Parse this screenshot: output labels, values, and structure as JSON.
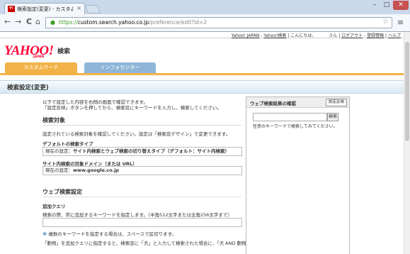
{
  "browser": {
    "tab_title": "検索設定(変更) - カスタム",
    "tab_favicon": "Y!",
    "url_scheme": "https://",
    "url_host": "custom.search.yahoo.co.jp",
    "url_path": "/preference/edit?id=2",
    "window_minimize": "–",
    "window_maximize": "□",
    "window_close": "✕",
    "back_icon": "←",
    "forward_icon": "→",
    "reload_icon": "C",
    "home_icon": "⌂",
    "star_icon": "☆",
    "menu_icon": "≡",
    "tab_close": "×"
  },
  "top_links": {
    "yahoo_japan": "Yahoo! JAPAN",
    "sep1": " - ",
    "yahoo_help": "Yahoo!検索",
    "greeting": " | こんにちは、",
    "user": "さん",
    "sep2": " | ",
    "logout": "ログアウト",
    "sep3": " - ",
    "register": "登録情報",
    "sep4": " | ",
    "help": "ヘルプ"
  },
  "logo": {
    "text": "YAHOO!",
    "sub": "JAPAN",
    "service": "検索"
  },
  "tabs": [
    {
      "label": "カスタムサーチ"
    },
    {
      "label": "インフォセンター"
    }
  ],
  "page_title": "検索設定(変更)",
  "intro": [
    "以下で設定した内容を右側の画面で確認できます。",
    "「設定反映」ボタンを押してから、検索窓にキーワードを入力し、検索してください。"
  ],
  "section_target": {
    "heading": "検索対象",
    "desc": "設定されている検索対象を確認してください。設定は「検索窓デザイン」で変更できます。",
    "default_label": "デフォルトの検索タイプ",
    "default_prefix": "現在の設定：",
    "default_value": "サイト内検索とウェブ検索の切り替えタイプ（デフォルト：サイト内検索）",
    "domain_label": "サイト内検索の対象ドメイン（または URL）",
    "domain_prefix": "現在の設定：",
    "domain_value": "www.google.co.jp"
  },
  "section_web": {
    "heading": "ウェブ検索設定",
    "query_label": "追加クエリ",
    "query_desc": "検索の際、常に追加するキーワードを指定します。（半角512文字または全角256文字まで）",
    "query_value": "",
    "note_mark": "※",
    "note": "複数のキーワードを指定する場合は、スペースで区切ります。",
    "example": "「動物」を追加クエリに指定すると、検索窓に「犬」と入力して検索された場合に、「犬 AND 動物」「犬」"
  },
  "right_panel": {
    "heading": "ウェブ検索結果の確認",
    "apply_button": "設定反映",
    "search_button": "検索",
    "search_value": "",
    "note": "任意のキーワードで検索してみてください。"
  },
  "colors": {
    "tab_custom": "#f2b248",
    "tab_info": "#8fb6d8",
    "logo_red": "#ff0033"
  }
}
